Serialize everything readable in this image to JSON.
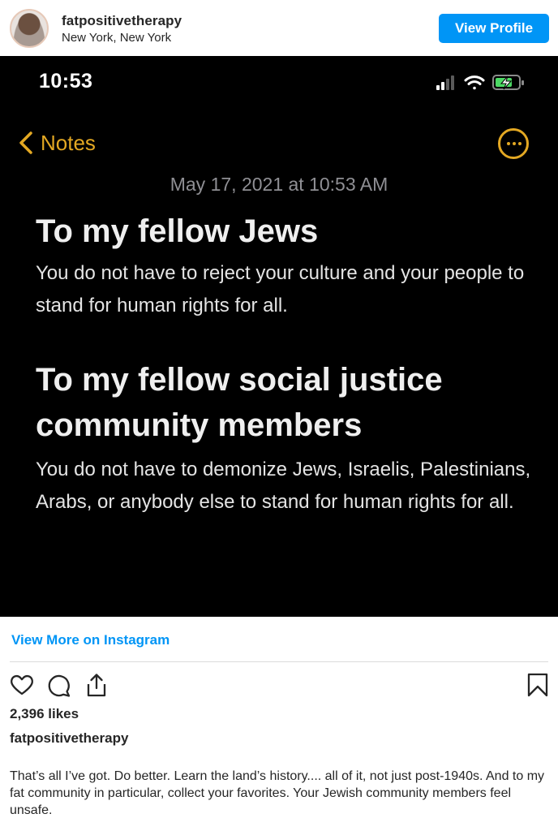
{
  "header": {
    "username": "fatpositivetherapy",
    "location": "New York, New York",
    "view_profile_label": "View Profile"
  },
  "post_image": {
    "status_time": "10:53",
    "back_label": "Notes",
    "date": "May 17, 2021 at 10:53 AM",
    "heading_1": "To my fellow Jews",
    "body_1": "You do not have to reject your culture and your people to stand for human rights for all.",
    "heading_2": "To my fellow social justice community members",
    "body_2": "You do not have to demonize Jews, Israelis, Palestinians, Arabs, or anybody else to stand for human rights for all.",
    "accent_color": "#e3a823"
  },
  "footer": {
    "view_more_label": "View More on Instagram",
    "likes": "2,396 likes",
    "caption_username": "fatpositivetherapy",
    "caption": "That’s all I’ve got. Do better. Learn the land’s history.... all of it, not just post-1940s. And to my fat community in particular, collect your favorites. Your Jewish community members feel unsafe.",
    "icons": [
      "heart-icon",
      "comment-icon",
      "share-icon",
      "bookmark-icon"
    ],
    "link_color": "#0095f6"
  }
}
